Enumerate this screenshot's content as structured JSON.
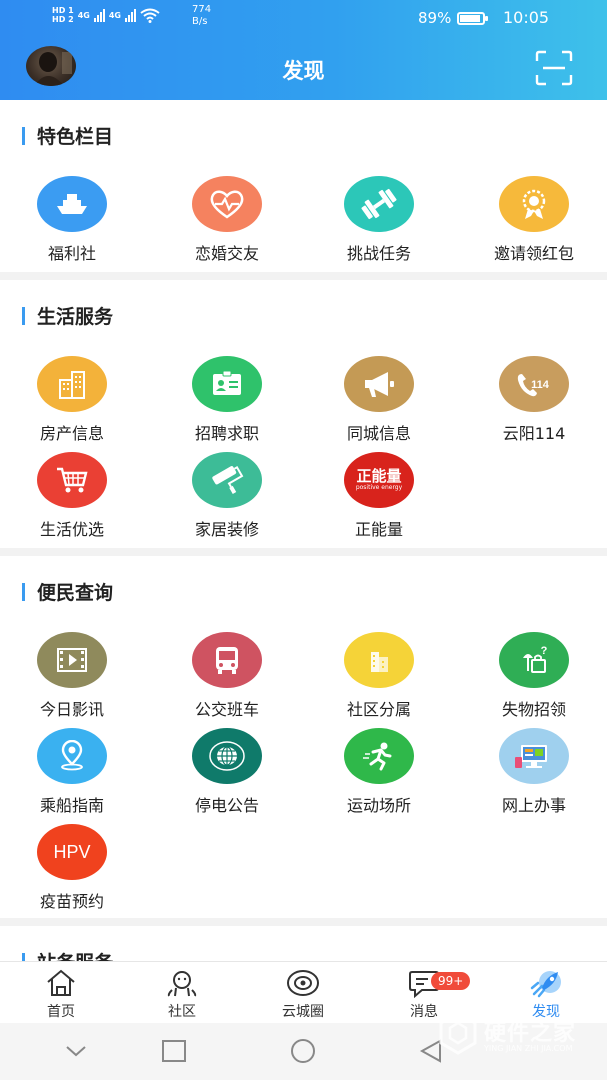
{
  "status": {
    "sim1": "HD 1",
    "sim2": "HD 2",
    "net1": "4G",
    "net2": "4G",
    "speed_value": "774",
    "speed_unit": "B/s",
    "battery": "89%",
    "battery_level": 0.89,
    "time": "10:05"
  },
  "header": {
    "title": "发现"
  },
  "sections": [
    {
      "title": "特色栏目",
      "items": [
        {
          "label": "福利社",
          "icon": "ship-icon",
          "color": "#3b9cf2"
        },
        {
          "label": "恋婚交友",
          "icon": "heart-pulse-icon",
          "color": "#f5825f"
        },
        {
          "label": "挑战任务",
          "icon": "dumbbell-icon",
          "color": "#2cc7b8"
        },
        {
          "label": "邀请领红包",
          "icon": "medal-icon",
          "color": "#f6b93b"
        }
      ]
    },
    {
      "title": "生活服务",
      "items": [
        {
          "label": "房产信息",
          "icon": "building-icon",
          "color": "#f3b23a"
        },
        {
          "label": "招聘求职",
          "icon": "id-card-icon",
          "color": "#2fc26b"
        },
        {
          "label": "同城信息",
          "icon": "megaphone-icon",
          "color": "#c49a55"
        },
        {
          "label": "云阳114",
          "icon": "phone-114-icon",
          "color": "#c89d5e"
        },
        {
          "label": "生活优选",
          "icon": "cart-icon",
          "color": "#ea4034"
        },
        {
          "label": "家居装修",
          "icon": "paint-roller-icon",
          "color": "#3dbc97"
        },
        {
          "label": "正能量",
          "icon": "positive-energy-icon",
          "color": "#d8231c",
          "icon_text": "正能量",
          "icon_sub": "positive energy"
        }
      ]
    },
    {
      "title": "便民查询",
      "items": [
        {
          "label": "今日影讯",
          "icon": "film-icon",
          "color": "#8f8a5c"
        },
        {
          "label": "公交班车",
          "icon": "bus-icon",
          "color": "#cf5361"
        },
        {
          "label": "社区分属",
          "icon": "community-icon",
          "color": "#f5d338"
        },
        {
          "label": "失物招领",
          "icon": "lost-found-icon",
          "color": "#2fae55"
        },
        {
          "label": "乘船指南",
          "icon": "location-pin-icon",
          "color": "#3ab1f0"
        },
        {
          "label": "停电公告",
          "icon": "state-grid-icon",
          "color": "#0f7a6a"
        },
        {
          "label": "运动场所",
          "icon": "runner-icon",
          "color": "#2fb84a"
        },
        {
          "label": "网上办事",
          "icon": "online-office-icon",
          "color": "#9fd0ee"
        },
        {
          "label": "疫苗预约",
          "icon": "hpv-icon",
          "color": "#f0421e",
          "icon_text": "HPV"
        }
      ]
    },
    {
      "title": "站务服务",
      "items": []
    }
  ],
  "tabs": [
    {
      "label": "首页",
      "icon": "home-icon"
    },
    {
      "label": "社区",
      "icon": "community-tab-icon"
    },
    {
      "label": "云城圈",
      "icon": "planet-icon"
    },
    {
      "label": "消息",
      "icon": "message-icon",
      "badge": "99+"
    },
    {
      "label": "发现",
      "icon": "rocket-icon",
      "active": true
    }
  ],
  "watermark": {
    "title": "硬件之家",
    "subtitle": "YING JIAN ZHI JIA.COM"
  },
  "colors": {
    "accent": "#2f8cf1",
    "header_end": "#3ec1ea",
    "badge": "#f04b3a"
  }
}
